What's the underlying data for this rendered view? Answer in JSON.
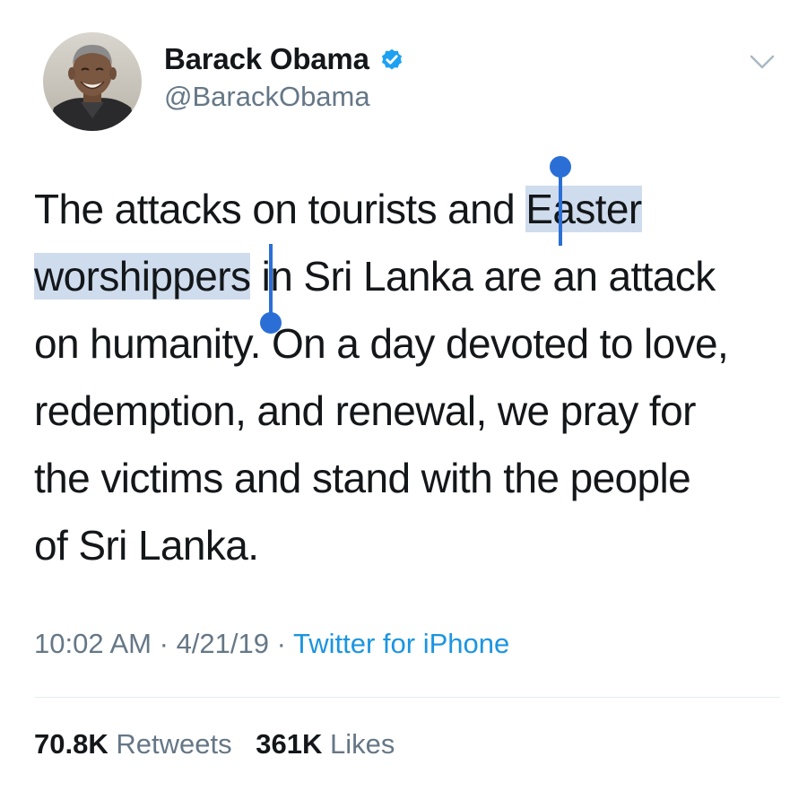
{
  "author": {
    "display_name": "Barack Obama",
    "handle": "@BarackObama",
    "verified": true,
    "avatar_icon": "profile-photo"
  },
  "tweet": {
    "lines": [
      {
        "before": "The attacks on tourists and ",
        "selected": "Easter",
        "after": ""
      },
      {
        "before": "",
        "selected": "worshippers",
        "after": " in Sri Lanka are an attack"
      },
      {
        "before": "on humanity. On a day devoted to love,",
        "selected": "",
        "after": ""
      },
      {
        "before": "redemption, and renewal, we pray for",
        "selected": "",
        "after": ""
      },
      {
        "before": "the victims and stand with the people",
        "selected": "",
        "after": ""
      },
      {
        "before": "of Sri Lanka.",
        "selected": "",
        "after": ""
      }
    ],
    "selected_text": "Easter worshippers"
  },
  "meta": {
    "time": "10:02 AM",
    "separator": "·",
    "date": "4/21/19",
    "source": "Twitter for iPhone"
  },
  "stats": {
    "retweets_count": "70.8K",
    "retweets_label": "Retweets",
    "likes_count": "361K",
    "likes_label": "Likes"
  },
  "colors": {
    "text": "#14171a",
    "secondary": "#657786",
    "link": "#1b95e0",
    "selection": "#cfdced",
    "selection_handle": "#2b6fd6",
    "verified": "#1da1f2"
  },
  "icons": {
    "verified": "verified-badge-icon",
    "caret": "chevron-down-icon"
  }
}
